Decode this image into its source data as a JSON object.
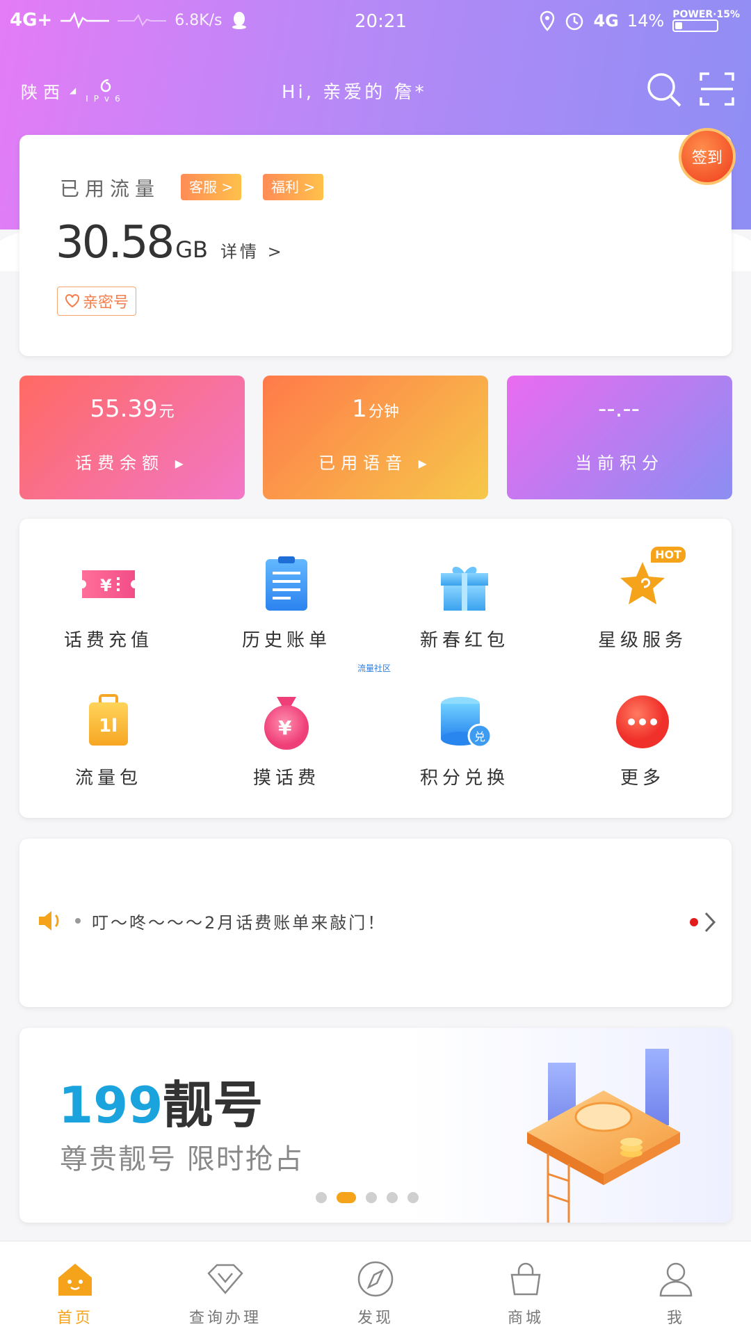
{
  "status_bar": {
    "network": "4G+",
    "speed": "6.8K/s",
    "time": "20:21",
    "battery_percent": "14%",
    "power_label": "POWER·15%",
    "signal_label": "4G"
  },
  "header": {
    "region": "陕西",
    "ipv6": "IPv6",
    "greeting": "Hi, 亲爱的 詹*"
  },
  "flow_card": {
    "title": "已用流量",
    "tag_service": "客服 >",
    "tag_welfare": "福利 >",
    "value": "30.58",
    "unit": "GB",
    "detail": "详情 >",
    "intimate": "亲密号",
    "signin": "签到"
  },
  "tiles": [
    {
      "value": "55.39",
      "unit": "元",
      "label": "话费余额 ▸"
    },
    {
      "value": "1",
      "unit": "分钟",
      "label": "已用语音 ▸"
    },
    {
      "value": "--.--",
      "unit": "",
      "label": "当前积分"
    }
  ],
  "services": [
    {
      "label": "话费充值"
    },
    {
      "label": "历史账单"
    },
    {
      "label": "新春红包"
    },
    {
      "label": "星级服务",
      "badge": "HOT"
    },
    {
      "label": "流量包"
    },
    {
      "label": "摸话费"
    },
    {
      "label": "积分兑换",
      "badge": "兑"
    },
    {
      "label": "更多"
    }
  ],
  "tiny_link": "流量社区",
  "notice": {
    "text": "叮～咚～～～2月话费账单来敲门！"
  },
  "banner": {
    "title_highlight": "199",
    "title_rest": "靓号",
    "subtitle": "尊贵靓号  限时抢占",
    "active_dot": 2,
    "dot_count": 5
  },
  "bottom_nav": [
    {
      "label": "首页",
      "icon": "home-icon",
      "active": true
    },
    {
      "label": "查询办理",
      "icon": "diamond-icon",
      "active": false
    },
    {
      "label": "发现",
      "icon": "compass-icon",
      "active": false
    },
    {
      "label": "商城",
      "icon": "bag-icon",
      "active": false
    },
    {
      "label": "我",
      "icon": "user-icon",
      "active": false
    }
  ],
  "colors": {
    "accent": "#f5a31b",
    "header_start": "#e47cf6",
    "header_end": "#8e8ef4",
    "link": "#1ba3de"
  }
}
